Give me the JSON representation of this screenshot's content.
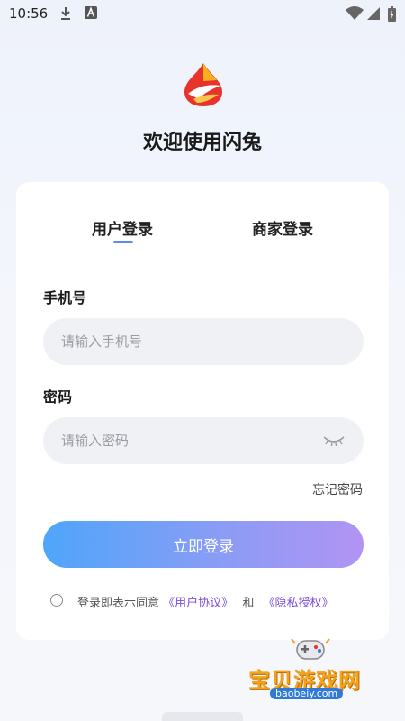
{
  "status_bar": {
    "time": "10:56",
    "icons": [
      "download-icon",
      "a-badge-icon",
      "wifi-icon",
      "cell-signal-icon",
      "battery-icon"
    ]
  },
  "header": {
    "welcome": "欢迎使用闪兔"
  },
  "tabs": {
    "user": "用户登录",
    "merchant": "商家登录",
    "active": "user",
    "indicator_color": "#5a8cf0"
  },
  "phone": {
    "label": "手机号",
    "placeholder": "请输入手机号",
    "value": ""
  },
  "password": {
    "label": "密码",
    "placeholder": "请输入密码",
    "value": ""
  },
  "forgot_password": "忘记密码",
  "login_button": {
    "label": "立即登录",
    "gradient": [
      "#4ea6fb",
      "#b194f3"
    ]
  },
  "agreement": {
    "prefix": "登录即表示同意",
    "user_agreement": "《用户协议》",
    "and": "和",
    "privacy": "《隐私授权》",
    "link_color": "#7b4fd8"
  },
  "watermark": {
    "title": "宝贝游戏网",
    "url": "baobeiy.com"
  }
}
